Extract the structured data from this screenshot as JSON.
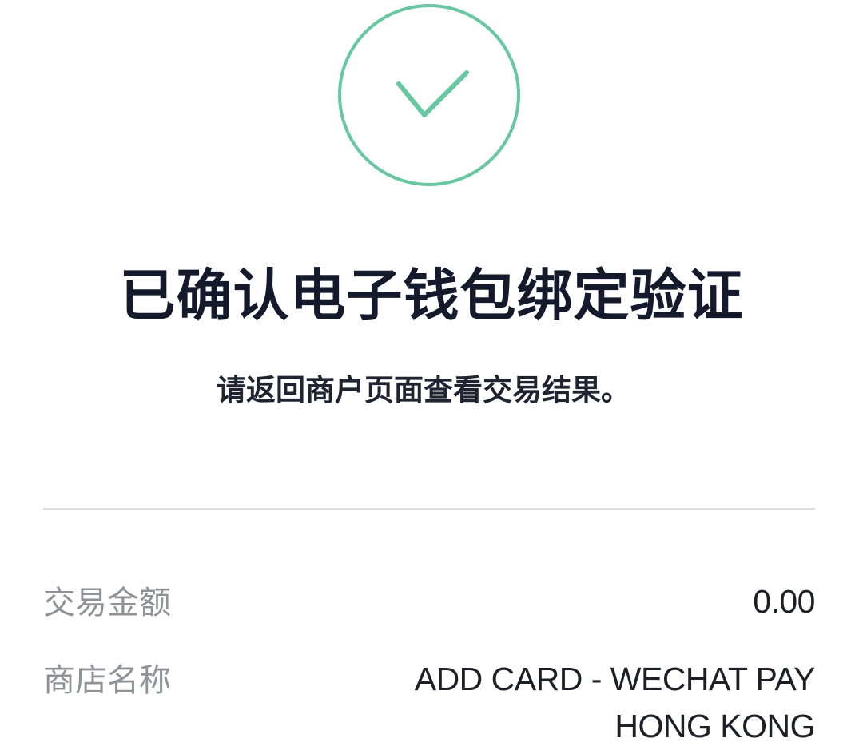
{
  "status": {
    "icon": "check-icon",
    "accent_color": "#66c7a1"
  },
  "title": "已确认电子钱包绑定验证",
  "subtitle": "请返回商户页面查看交易结果。",
  "details": {
    "amount_label": "交易金额",
    "amount_value": "0.00",
    "merchant_label": "商店名称",
    "merchant_value": "ADD CARD - WECHAT PAY HONG KONG"
  }
}
